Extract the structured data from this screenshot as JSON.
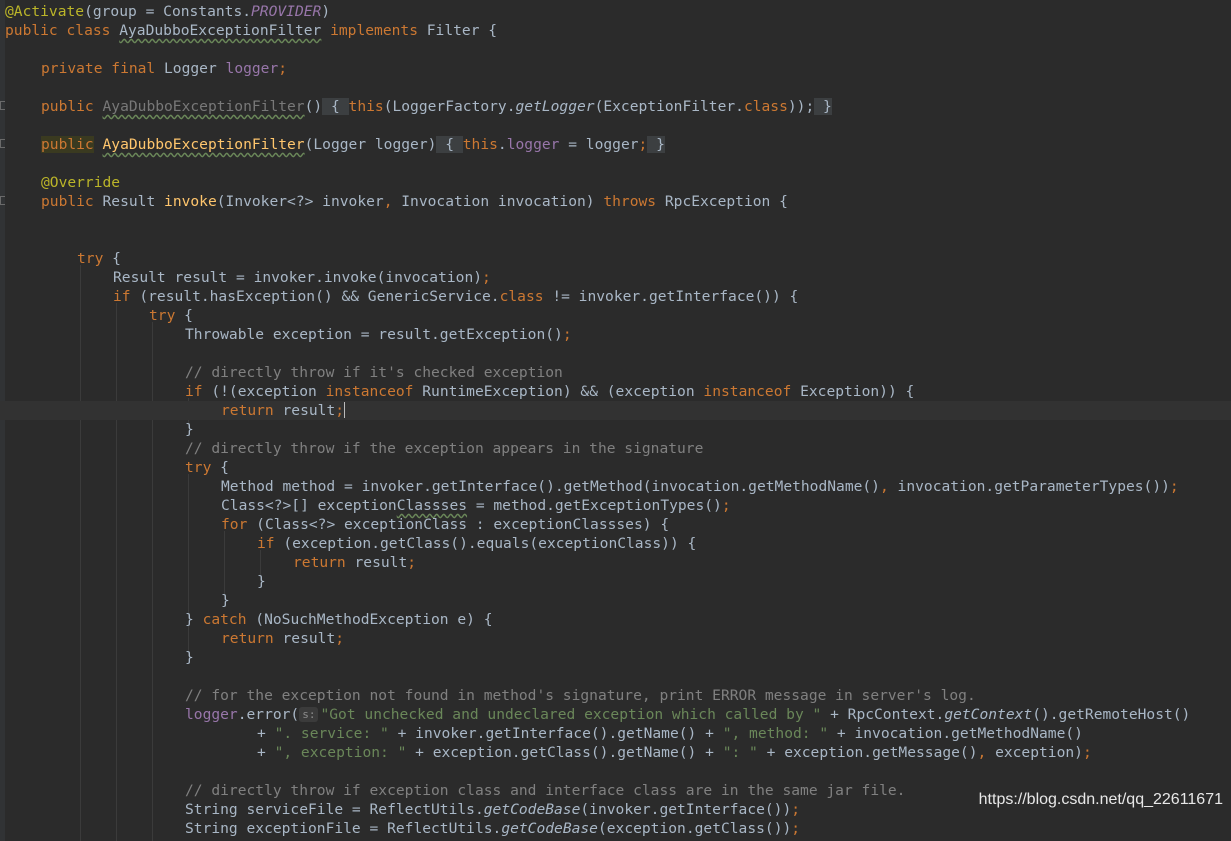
{
  "code": {
    "l1_ann": "@Activate",
    "l1_a": "(group = Constants.",
    "l1_const": "PROVIDER",
    "l1_b": ")",
    "l2_kw": "public class ",
    "l2_cls": "AyaDubboExceptionFilter",
    "l2_impl": " implements ",
    "l2_rest": "Filter {",
    "l4_kw": "private final ",
    "l4_type": "Logger ",
    "l4_field": "logger",
    "l4_semi": ";",
    "l6_kw": "public ",
    "l6_ctor": "AyaDubboExceptionFilter",
    "l6_a": "()",
    "l6_b1": " { ",
    "l6_this": "this",
    "l6_c": "(LoggerFactory.",
    "l6_get": "getLogger",
    "l6_d": "(ExceptionFilter.",
    "l6_class": "class",
    "l6_e": "));",
    "l6_b2": " }",
    "l8_kw": "public",
    "l8_ctor": "AyaDubboExceptionFilter",
    "l8_a": "(Logger logger)",
    "l8_b1": " { ",
    "l8_this": "this",
    "l8_dot": ".",
    "l8_field": "logger",
    "l8_eq": " = logger",
    "l8_semi": ";",
    "l8_b2": " }",
    "l10_ann": "@Override",
    "l11_kw": "public ",
    "l11_type": "Result ",
    "l11_fn": "invoke",
    "l11_a": "(Invoker<?> invoker",
    "l11_comma": ", ",
    "l11_b": "Invocation invocation) ",
    "l11_throws": "throws ",
    "l11_c": "RpcException {",
    "l14_try": "try",
    "l14_a": " {",
    "l15_a": "Result result = invoker.invoke(invocation)",
    "l15_semi": ";",
    "l16_if": "if ",
    "l16_a": "(result.hasException() && GenericService.",
    "l16_class": "class",
    "l16_b": " != invoker.getInterface()) {",
    "l17_try": "try",
    "l17_a": " {",
    "l18_a": "Throwable exception = result.getException()",
    "l18_semi": ";",
    "l20_cm": "// directly throw if it's checked exception",
    "l21_if": "if ",
    "l21_a": "(!(exception ",
    "l21_inst": "instanceof",
    "l21_b": " RuntimeException) && (exception ",
    "l21_inst2": "instanceof",
    "l21_c": " Exception)) {",
    "l22_ret": "return ",
    "l22_a": "result",
    "l22_semi": ";",
    "l23_a": "}",
    "l24_cm": "// directly throw if the exception appears in the signature",
    "l25_try": "try",
    "l25_a": " {",
    "l26_a": "Method method = invoker.getInterface().getMethod(invocation.getMethodName()",
    "l26_comma": ", ",
    "l26_b": "invocation.getParameterTypes())",
    "l26_semi": ";",
    "l27_a": "Class<?>[] exception",
    "l27_ul": "Classses",
    "l27_b": " = method.getExceptionTypes()",
    "l27_semi": ";",
    "l28_for": "for ",
    "l28_a": "(Class<?> exceptionClass : exceptionClassses) {",
    "l29_if": "if ",
    "l29_a": "(exception.getClass().equals(exceptionClass)) {",
    "l30_ret": "return ",
    "l30_a": "result",
    "l30_semi": ";",
    "l31_a": "}",
    "l32_a": "}",
    "l33_a": "} ",
    "l33_catch": "catch ",
    "l33_b": "(NoSuchMethodException e) {",
    "l34_ret": "return ",
    "l34_a": "result",
    "l34_semi": ";",
    "l35_a": "}",
    "l37_cm": "// for the exception not found in method's signature, print ERROR message in server's log.",
    "l38_field": "logger",
    "l38_a": ".error(",
    "l38_hint": "s:",
    "l38_str": "\"Got unchecked and undeclared exception which called by \"",
    "l38_b": " + RpcContext.",
    "l38_ctx": "getContext",
    "l38_c": "().getRemoteHost()",
    "l39_a": "+ ",
    "l39_str": "\". service: \"",
    "l39_b": " + invoker.getInterface().getName() + ",
    "l39_str2": "\", method: \"",
    "l39_c": " + invocation.getMethodName()",
    "l40_a": "+ ",
    "l40_str": "\", exception: \"",
    "l40_b": " + exception.getClass().getName() + ",
    "l40_str2": "\": \"",
    "l40_c": " + exception.getMessage()",
    "l40_comma": ", ",
    "l40_d": "exception)",
    "l40_semi": ";",
    "l42_cm": "// directly throw if exception class and interface class are in the same jar file.",
    "l43_a": "String serviceFile = ReflectUtils.",
    "l43_it": "getCodeBase",
    "l43_b": "(invoker.getInterface())",
    "l43_semi": ";",
    "l44_a": "String exceptionFile = ReflectUtils.",
    "l44_it": "getCodeBase",
    "l44_b": "(exception.getClass())",
    "l44_semi": ";"
  },
  "watermark": "https://blog.csdn.net/qq_22611671",
  "colors": {
    "background": "#2b2b2b",
    "keyword": "#cc7832",
    "annotation": "#bbb529",
    "field": "#9876aa",
    "method": "#ffc66d",
    "string": "#6a8759",
    "comment": "#808080",
    "text": "#a9b7c6"
  }
}
